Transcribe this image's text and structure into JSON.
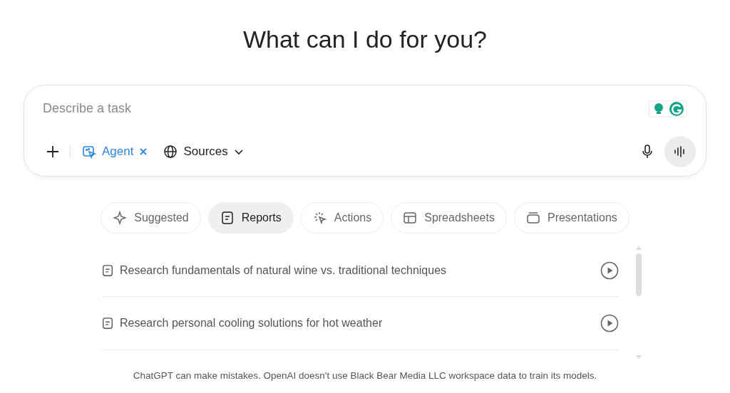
{
  "heading": "What can I do for you?",
  "composer": {
    "placeholder": "Describe a task",
    "agent_chip": {
      "label": "Agent",
      "selected": true
    },
    "sources": {
      "label": "Sources"
    }
  },
  "tabs": [
    {
      "label": "Suggested",
      "kind": "sparkle",
      "selected": false
    },
    {
      "label": "Reports",
      "kind": "document",
      "selected": true
    },
    {
      "label": "Actions",
      "kind": "cursor",
      "selected": false
    },
    {
      "label": "Spreadsheets",
      "kind": "table",
      "selected": false
    },
    {
      "label": "Presentations",
      "kind": "slides",
      "selected": false
    }
  ],
  "prompts": [
    {
      "text": "Research fundamentals of natural wine vs. traditional techniques"
    },
    {
      "text": "Research personal cooling solutions for hot weather"
    }
  ],
  "footer": "ChatGPT can make mistakes. OpenAI doesn't use Black Bear Media LLC workspace data to train its models."
}
